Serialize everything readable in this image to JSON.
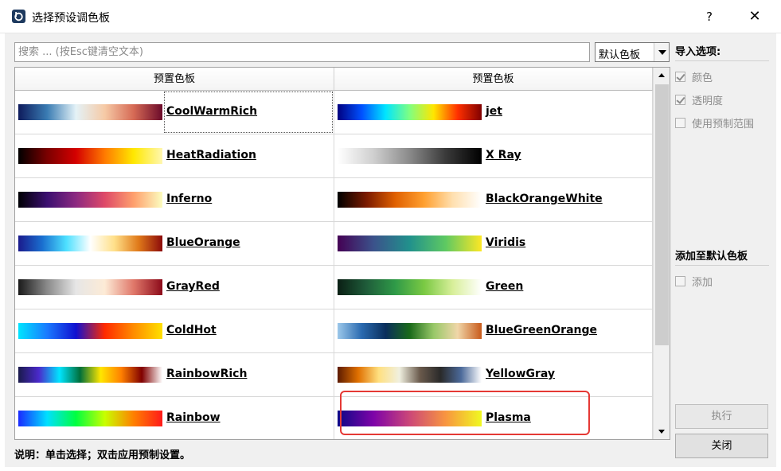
{
  "window": {
    "title": "选择预设调色板",
    "help_label": "?",
    "close_label": "✕"
  },
  "search": {
    "value": "",
    "placeholder": "搜索 ... (按Esc键清空文本)"
  },
  "combo": {
    "selected": "默认色板"
  },
  "grid": {
    "columns": [
      "预置色板",
      "预置色板"
    ],
    "rows": [
      [
        {
          "name": "CoolWarmRich",
          "colors": [
            "#0e1b5c",
            "#3a7cb3",
            "#e4f2f7",
            "#f6caa6",
            "#d66a55",
            "#6b0a2a"
          ]
        },
        {
          "name": "jet",
          "colors": [
            "#000080",
            "#0050ff",
            "#00e5ff",
            "#80ff80",
            "#ffe600",
            "#ff3000",
            "#800000"
          ]
        }
      ],
      [
        {
          "name": "HeatRadiation",
          "colors": [
            "#000000",
            "#7a0000",
            "#d40000",
            "#ff7a00",
            "#ffe800",
            "#fff7b0"
          ]
        },
        {
          "name": "X Ray",
          "colors": [
            "#ffffff",
            "#cfcfcf",
            "#8a8a8a",
            "#3a3a3a",
            "#000000"
          ]
        }
      ],
      [
        {
          "name": "Inferno",
          "colors": [
            "#000004",
            "#3b0f70",
            "#8c2981",
            "#de4968",
            "#fe9f6d",
            "#fcfdbf"
          ]
        },
        {
          "name": "BlackOrangeWhite",
          "colors": [
            "#000000",
            "#7a1a00",
            "#e06000",
            "#ffa030",
            "#ffe0b0",
            "#ffffff"
          ]
        }
      ],
      [
        {
          "name": "BlueOrange",
          "colors": [
            "#1a1a8c",
            "#1a6fd0",
            "#4de0ff",
            "#ffffff",
            "#ffe089",
            "#e07a1a",
            "#8c0a0a"
          ]
        },
        {
          "name": "Viridis",
          "colors": [
            "#440154",
            "#3b528b",
            "#21918c",
            "#5ec962",
            "#fde725"
          ]
        }
      ],
      [
        {
          "name": "GrayRed",
          "colors": [
            "#1a1a1a",
            "#8a8a8a",
            "#e6e6e6",
            "#fdebd6",
            "#e0786a",
            "#8c0a1a"
          ]
        },
        {
          "name": "Green",
          "colors": [
            "#0a1f14",
            "#1f5c3a",
            "#2f9a48",
            "#7ac943",
            "#d8ef9a",
            "#ffffff"
          ]
        }
      ],
      [
        {
          "name": "ColdHot",
          "colors": [
            "#00e5ff",
            "#1a7aff",
            "#1010d0",
            "#ff2a00",
            "#ff8c00",
            "#ffe000"
          ]
        },
        {
          "name": "BlueGreenOrange",
          "colors": [
            "#9cc8ea",
            "#2a6ab0",
            "#0a2e5c",
            "#1a6a1a",
            "#98c868",
            "#f0d6a8",
            "#c85a1a"
          ]
        }
      ],
      [
        {
          "name": "RainbowRich",
          "colors": [
            "#1a1a4c",
            "#4a2acc",
            "#00e5ff",
            "#006f3a",
            "#ffe600",
            "#ff8000",
            "#800000",
            "#ffffff"
          ]
        },
        {
          "name": "YellowGray",
          "colors": [
            "#5c1a00",
            "#e07000",
            "#ffe080",
            "#f0f0e0",
            "#6a5a4c",
            "#2a2a2a",
            "#4c6a9a",
            "#ffffff"
          ]
        }
      ],
      [
        {
          "name": "Rainbow",
          "colors": [
            "#1a2aff",
            "#00e0ff",
            "#00ff40",
            "#c8ff00",
            "#ff8000",
            "#ff1a1a"
          ]
        },
        {
          "name": "Plasma",
          "colors": [
            "#0d0887",
            "#7e03a8",
            "#cc4778",
            "#f89540",
            "#f0f921"
          ]
        }
      ]
    ]
  },
  "hint": "说明：单击选择；双击应用预制设置。",
  "import_options": {
    "title": "导入选项:",
    "items": [
      {
        "label": "颜色",
        "checked": true
      },
      {
        "label": "透明度",
        "checked": true
      },
      {
        "label": "使用预制范围",
        "checked": false
      }
    ]
  },
  "add_default": {
    "title": "添加至默认色板",
    "items": [
      {
        "label": "添加",
        "checked": false
      }
    ]
  },
  "buttons": {
    "execute": "执行",
    "close": "关闭"
  },
  "accent": "#e53935"
}
